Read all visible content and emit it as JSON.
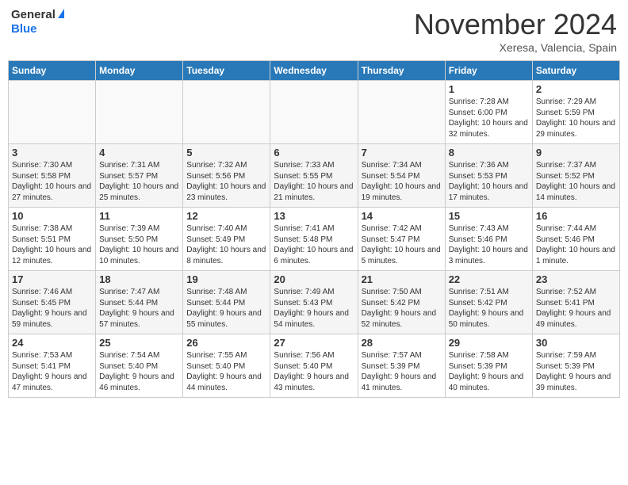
{
  "header": {
    "logo_general": "General",
    "logo_blue": "Blue",
    "month_title": "November 2024",
    "location": "Xeresa, Valencia, Spain"
  },
  "days_of_week": [
    "Sunday",
    "Monday",
    "Tuesday",
    "Wednesday",
    "Thursday",
    "Friday",
    "Saturday"
  ],
  "weeks": [
    [
      {
        "day": "",
        "info": ""
      },
      {
        "day": "",
        "info": ""
      },
      {
        "day": "",
        "info": ""
      },
      {
        "day": "",
        "info": ""
      },
      {
        "day": "",
        "info": ""
      },
      {
        "day": "1",
        "info": "Sunrise: 7:28 AM\nSunset: 6:00 PM\nDaylight: 10 hours and 32 minutes."
      },
      {
        "day": "2",
        "info": "Sunrise: 7:29 AM\nSunset: 5:59 PM\nDaylight: 10 hours and 29 minutes."
      }
    ],
    [
      {
        "day": "3",
        "info": "Sunrise: 7:30 AM\nSunset: 5:58 PM\nDaylight: 10 hours and 27 minutes."
      },
      {
        "day": "4",
        "info": "Sunrise: 7:31 AM\nSunset: 5:57 PM\nDaylight: 10 hours and 25 minutes."
      },
      {
        "day": "5",
        "info": "Sunrise: 7:32 AM\nSunset: 5:56 PM\nDaylight: 10 hours and 23 minutes."
      },
      {
        "day": "6",
        "info": "Sunrise: 7:33 AM\nSunset: 5:55 PM\nDaylight: 10 hours and 21 minutes."
      },
      {
        "day": "7",
        "info": "Sunrise: 7:34 AM\nSunset: 5:54 PM\nDaylight: 10 hours and 19 minutes."
      },
      {
        "day": "8",
        "info": "Sunrise: 7:36 AM\nSunset: 5:53 PM\nDaylight: 10 hours and 17 minutes."
      },
      {
        "day": "9",
        "info": "Sunrise: 7:37 AM\nSunset: 5:52 PM\nDaylight: 10 hours and 14 minutes."
      }
    ],
    [
      {
        "day": "10",
        "info": "Sunrise: 7:38 AM\nSunset: 5:51 PM\nDaylight: 10 hours and 12 minutes."
      },
      {
        "day": "11",
        "info": "Sunrise: 7:39 AM\nSunset: 5:50 PM\nDaylight: 10 hours and 10 minutes."
      },
      {
        "day": "12",
        "info": "Sunrise: 7:40 AM\nSunset: 5:49 PM\nDaylight: 10 hours and 8 minutes."
      },
      {
        "day": "13",
        "info": "Sunrise: 7:41 AM\nSunset: 5:48 PM\nDaylight: 10 hours and 6 minutes."
      },
      {
        "day": "14",
        "info": "Sunrise: 7:42 AM\nSunset: 5:47 PM\nDaylight: 10 hours and 5 minutes."
      },
      {
        "day": "15",
        "info": "Sunrise: 7:43 AM\nSunset: 5:46 PM\nDaylight: 10 hours and 3 minutes."
      },
      {
        "day": "16",
        "info": "Sunrise: 7:44 AM\nSunset: 5:46 PM\nDaylight: 10 hours and 1 minute."
      }
    ],
    [
      {
        "day": "17",
        "info": "Sunrise: 7:46 AM\nSunset: 5:45 PM\nDaylight: 9 hours and 59 minutes."
      },
      {
        "day": "18",
        "info": "Sunrise: 7:47 AM\nSunset: 5:44 PM\nDaylight: 9 hours and 57 minutes."
      },
      {
        "day": "19",
        "info": "Sunrise: 7:48 AM\nSunset: 5:44 PM\nDaylight: 9 hours and 55 minutes."
      },
      {
        "day": "20",
        "info": "Sunrise: 7:49 AM\nSunset: 5:43 PM\nDaylight: 9 hours and 54 minutes."
      },
      {
        "day": "21",
        "info": "Sunrise: 7:50 AM\nSunset: 5:42 PM\nDaylight: 9 hours and 52 minutes."
      },
      {
        "day": "22",
        "info": "Sunrise: 7:51 AM\nSunset: 5:42 PM\nDaylight: 9 hours and 50 minutes."
      },
      {
        "day": "23",
        "info": "Sunrise: 7:52 AM\nSunset: 5:41 PM\nDaylight: 9 hours and 49 minutes."
      }
    ],
    [
      {
        "day": "24",
        "info": "Sunrise: 7:53 AM\nSunset: 5:41 PM\nDaylight: 9 hours and 47 minutes."
      },
      {
        "day": "25",
        "info": "Sunrise: 7:54 AM\nSunset: 5:40 PM\nDaylight: 9 hours and 46 minutes."
      },
      {
        "day": "26",
        "info": "Sunrise: 7:55 AM\nSunset: 5:40 PM\nDaylight: 9 hours and 44 minutes."
      },
      {
        "day": "27",
        "info": "Sunrise: 7:56 AM\nSunset: 5:40 PM\nDaylight: 9 hours and 43 minutes."
      },
      {
        "day": "28",
        "info": "Sunrise: 7:57 AM\nSunset: 5:39 PM\nDaylight: 9 hours and 41 minutes."
      },
      {
        "day": "29",
        "info": "Sunrise: 7:58 AM\nSunset: 5:39 PM\nDaylight: 9 hours and 40 minutes."
      },
      {
        "day": "30",
        "info": "Sunrise: 7:59 AM\nSunset: 5:39 PM\nDaylight: 9 hours and 39 minutes."
      }
    ]
  ]
}
